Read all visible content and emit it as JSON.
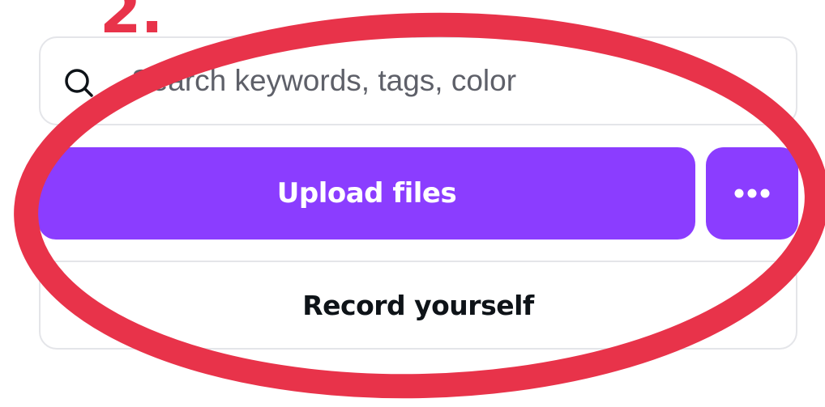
{
  "annotation": {
    "step_number": "2.",
    "color": "#e8334a"
  },
  "search": {
    "placeholder": "Search keywords, tags, color",
    "icon": "search-icon"
  },
  "actions": {
    "upload_label": "Upload files",
    "more_icon": "more-horizontal-icon",
    "record_label": "Record yourself"
  },
  "colors": {
    "primary": "#8b3dff",
    "button_text": "#ffffff",
    "border": "#e4e5e9",
    "text": "#0e1318"
  }
}
